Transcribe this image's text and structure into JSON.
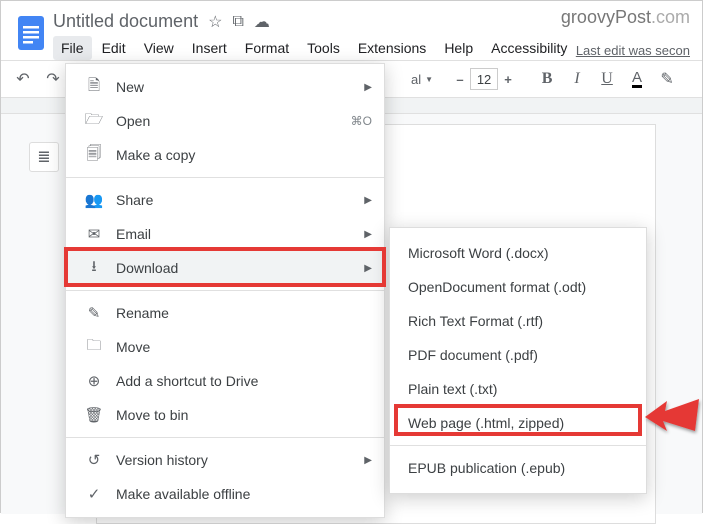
{
  "brand": {
    "main": "groovy",
    "accent": "Post",
    "tld": ".com"
  },
  "title": {
    "doc_name": "Untitled document",
    "star_icon": "☆",
    "folder_icon": "⧉",
    "cloud_icon": "☁"
  },
  "menubar": {
    "items": [
      "File",
      "Edit",
      "View",
      "Insert",
      "Format",
      "Tools",
      "Extensions",
      "Help",
      "Accessibility"
    ],
    "active_index": 0,
    "last_edit": "Last edit was secon"
  },
  "toolbar": {
    "undo": "↶",
    "redo": "↷",
    "font_partial": "al",
    "minus": "–",
    "font_size": "12",
    "plus": "+",
    "bold": "B",
    "italic": "I",
    "underline": "U",
    "color": "A",
    "highlighter": "✎"
  },
  "outline_icon": "≣",
  "file_menu": {
    "items": [
      {
        "icon": "🗎",
        "label": "New",
        "arrow": true
      },
      {
        "icon": "🗁",
        "label": "Open",
        "shortcut": "⌘O"
      },
      {
        "icon": "🗐",
        "label": "Make a copy"
      },
      {
        "sep": true
      },
      {
        "icon": "👥",
        "label": "Share",
        "arrow": true
      },
      {
        "icon": "✉",
        "label": "Email",
        "arrow": true
      },
      {
        "icon": "⭳",
        "label": "Download",
        "arrow": true,
        "highlight": true
      },
      {
        "sep": true
      },
      {
        "icon": "✎",
        "label": "Rename"
      },
      {
        "icon": "🗀",
        "label": "Move"
      },
      {
        "icon": "⊕",
        "label": "Add a shortcut to Drive"
      },
      {
        "icon": "🗑",
        "label": "Move to bin"
      },
      {
        "sep": true
      },
      {
        "icon": "↺",
        "label": "Version history",
        "arrow": true
      },
      {
        "icon": "✓",
        "label": "Make available offline"
      }
    ]
  },
  "download_menu": {
    "items": [
      {
        "label": "Microsoft Word (.docx)"
      },
      {
        "label": "OpenDocument format (.odt)"
      },
      {
        "label": "Rich Text Format (.rtf)"
      },
      {
        "label": "PDF document (.pdf)"
      },
      {
        "label": "Plain text (.txt)"
      },
      {
        "label": "Web page (.html, zipped)",
        "highlight": true
      },
      {
        "label": "EPUB publication (.epub)"
      }
    ]
  },
  "annotations": {
    "highlight_color": "#e53935"
  }
}
